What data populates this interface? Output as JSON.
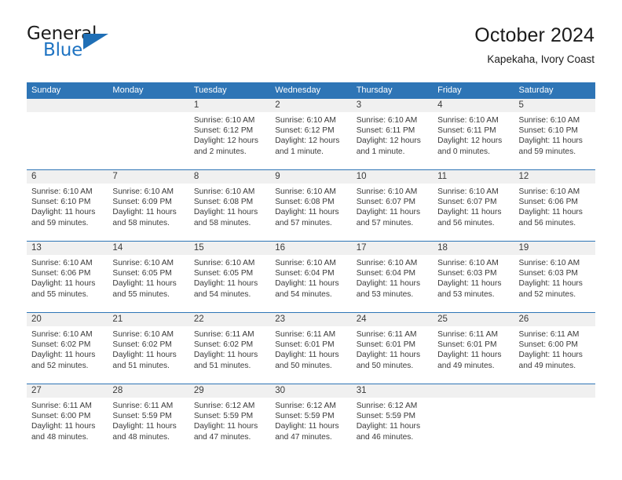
{
  "brand": {
    "name_top": "General",
    "name_bottom": "Blue",
    "accent_color": "#1f6fb6"
  },
  "header": {
    "title": "October 2024",
    "subtitle": "Kapekaha, Ivory Coast"
  },
  "colors": {
    "header_row_bg": "#2e75b6",
    "day_band_bg": "#f0f0f0",
    "separator": "#2e75b6",
    "text": "#3a3a3a"
  },
  "weekdays": [
    "Sunday",
    "Monday",
    "Tuesday",
    "Wednesday",
    "Thursday",
    "Friday",
    "Saturday"
  ],
  "labels": {
    "sunrise_prefix": "Sunrise: ",
    "sunset_prefix": "Sunset: ",
    "daylight_prefix": "Daylight: "
  },
  "weeks": [
    [
      {
        "empty": true
      },
      {
        "empty": true
      },
      {
        "day": "1",
        "sunrise": "Sunrise: 6:10 AM",
        "sunset": "Sunset: 6:12 PM",
        "daylight": "Daylight: 12 hours and 2 minutes."
      },
      {
        "day": "2",
        "sunrise": "Sunrise: 6:10 AM",
        "sunset": "Sunset: 6:12 PM",
        "daylight": "Daylight: 12 hours and 1 minute."
      },
      {
        "day": "3",
        "sunrise": "Sunrise: 6:10 AM",
        "sunset": "Sunset: 6:11 PM",
        "daylight": "Daylight: 12 hours and 1 minute."
      },
      {
        "day": "4",
        "sunrise": "Sunrise: 6:10 AM",
        "sunset": "Sunset: 6:11 PM",
        "daylight": "Daylight: 12 hours and 0 minutes."
      },
      {
        "day": "5",
        "sunrise": "Sunrise: 6:10 AM",
        "sunset": "Sunset: 6:10 PM",
        "daylight": "Daylight: 11 hours and 59 minutes."
      }
    ],
    [
      {
        "day": "6",
        "sunrise": "Sunrise: 6:10 AM",
        "sunset": "Sunset: 6:10 PM",
        "daylight": "Daylight: 11 hours and 59 minutes."
      },
      {
        "day": "7",
        "sunrise": "Sunrise: 6:10 AM",
        "sunset": "Sunset: 6:09 PM",
        "daylight": "Daylight: 11 hours and 58 minutes."
      },
      {
        "day": "8",
        "sunrise": "Sunrise: 6:10 AM",
        "sunset": "Sunset: 6:08 PM",
        "daylight": "Daylight: 11 hours and 58 minutes."
      },
      {
        "day": "9",
        "sunrise": "Sunrise: 6:10 AM",
        "sunset": "Sunset: 6:08 PM",
        "daylight": "Daylight: 11 hours and 57 minutes."
      },
      {
        "day": "10",
        "sunrise": "Sunrise: 6:10 AM",
        "sunset": "Sunset: 6:07 PM",
        "daylight": "Daylight: 11 hours and 57 minutes."
      },
      {
        "day": "11",
        "sunrise": "Sunrise: 6:10 AM",
        "sunset": "Sunset: 6:07 PM",
        "daylight": "Daylight: 11 hours and 56 minutes."
      },
      {
        "day": "12",
        "sunrise": "Sunrise: 6:10 AM",
        "sunset": "Sunset: 6:06 PM",
        "daylight": "Daylight: 11 hours and 56 minutes."
      }
    ],
    [
      {
        "day": "13",
        "sunrise": "Sunrise: 6:10 AM",
        "sunset": "Sunset: 6:06 PM",
        "daylight": "Daylight: 11 hours and 55 minutes."
      },
      {
        "day": "14",
        "sunrise": "Sunrise: 6:10 AM",
        "sunset": "Sunset: 6:05 PM",
        "daylight": "Daylight: 11 hours and 55 minutes."
      },
      {
        "day": "15",
        "sunrise": "Sunrise: 6:10 AM",
        "sunset": "Sunset: 6:05 PM",
        "daylight": "Daylight: 11 hours and 54 minutes."
      },
      {
        "day": "16",
        "sunrise": "Sunrise: 6:10 AM",
        "sunset": "Sunset: 6:04 PM",
        "daylight": "Daylight: 11 hours and 54 minutes."
      },
      {
        "day": "17",
        "sunrise": "Sunrise: 6:10 AM",
        "sunset": "Sunset: 6:04 PM",
        "daylight": "Daylight: 11 hours and 53 minutes."
      },
      {
        "day": "18",
        "sunrise": "Sunrise: 6:10 AM",
        "sunset": "Sunset: 6:03 PM",
        "daylight": "Daylight: 11 hours and 53 minutes."
      },
      {
        "day": "19",
        "sunrise": "Sunrise: 6:10 AM",
        "sunset": "Sunset: 6:03 PM",
        "daylight": "Daylight: 11 hours and 52 minutes."
      }
    ],
    [
      {
        "day": "20",
        "sunrise": "Sunrise: 6:10 AM",
        "sunset": "Sunset: 6:02 PM",
        "daylight": "Daylight: 11 hours and 52 minutes."
      },
      {
        "day": "21",
        "sunrise": "Sunrise: 6:10 AM",
        "sunset": "Sunset: 6:02 PM",
        "daylight": "Daylight: 11 hours and 51 minutes."
      },
      {
        "day": "22",
        "sunrise": "Sunrise: 6:11 AM",
        "sunset": "Sunset: 6:02 PM",
        "daylight": "Daylight: 11 hours and 51 minutes."
      },
      {
        "day": "23",
        "sunrise": "Sunrise: 6:11 AM",
        "sunset": "Sunset: 6:01 PM",
        "daylight": "Daylight: 11 hours and 50 minutes."
      },
      {
        "day": "24",
        "sunrise": "Sunrise: 6:11 AM",
        "sunset": "Sunset: 6:01 PM",
        "daylight": "Daylight: 11 hours and 50 minutes."
      },
      {
        "day": "25",
        "sunrise": "Sunrise: 6:11 AM",
        "sunset": "Sunset: 6:01 PM",
        "daylight": "Daylight: 11 hours and 49 minutes."
      },
      {
        "day": "26",
        "sunrise": "Sunrise: 6:11 AM",
        "sunset": "Sunset: 6:00 PM",
        "daylight": "Daylight: 11 hours and 49 minutes."
      }
    ],
    [
      {
        "day": "27",
        "sunrise": "Sunrise: 6:11 AM",
        "sunset": "Sunset: 6:00 PM",
        "daylight": "Daylight: 11 hours and 48 minutes."
      },
      {
        "day": "28",
        "sunrise": "Sunrise: 6:11 AM",
        "sunset": "Sunset: 5:59 PM",
        "daylight": "Daylight: 11 hours and 48 minutes."
      },
      {
        "day": "29",
        "sunrise": "Sunrise: 6:12 AM",
        "sunset": "Sunset: 5:59 PM",
        "daylight": "Daylight: 11 hours and 47 minutes."
      },
      {
        "day": "30",
        "sunrise": "Sunrise: 6:12 AM",
        "sunset": "Sunset: 5:59 PM",
        "daylight": "Daylight: 11 hours and 47 minutes."
      },
      {
        "day": "31",
        "sunrise": "Sunrise: 6:12 AM",
        "sunset": "Sunset: 5:59 PM",
        "daylight": "Daylight: 11 hours and 46 minutes."
      },
      {
        "empty": true
      },
      {
        "empty": true
      }
    ]
  ]
}
